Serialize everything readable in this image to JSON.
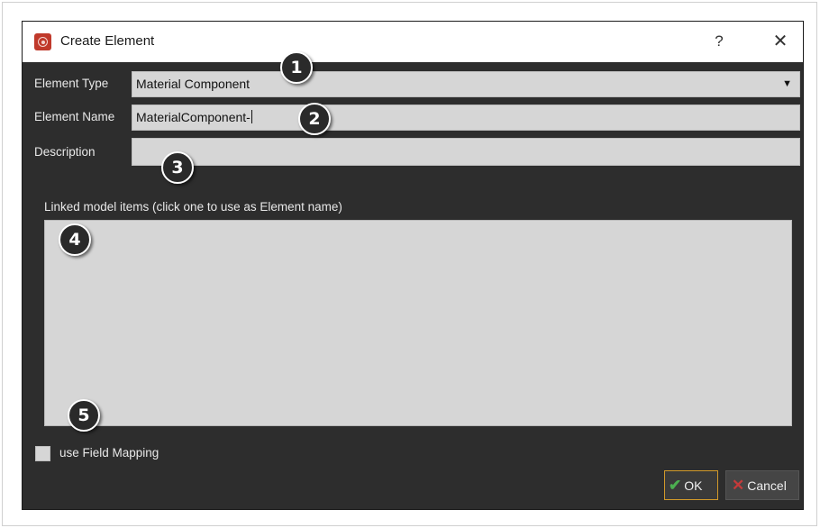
{
  "dialog": {
    "title": "Create Element",
    "help_label": "?",
    "close_label": "✕"
  },
  "form": {
    "element_type_label": "Element Type",
    "element_type_value": "Material Component",
    "element_name_label": "Element Name",
    "element_name_value": "MaterialComponent-",
    "description_label": "Description",
    "description_value": "",
    "linked_items_label": "Linked model items   (click one to use as Element name)",
    "linked_items": [],
    "field_mapping_label": "use Field Mapping",
    "field_mapping_checked": false
  },
  "buttons": {
    "ok_label": "OK",
    "cancel_label": "Cancel"
  },
  "callouts": [
    "1",
    "2",
    "3",
    "4",
    "5"
  ],
  "icons": {
    "app": "app-logo-icon",
    "dropdown": "chevron-down-icon",
    "ok": "checkmark-icon",
    "cancel": "x-icon"
  },
  "colors": {
    "window_bg": "#2d2d2d",
    "field_bg": "#d6d6d6",
    "ok_border": "#d29a2a",
    "check_green": "#4caf50",
    "cancel_red": "#c43a3a",
    "app_icon_red": "#c0392b"
  }
}
